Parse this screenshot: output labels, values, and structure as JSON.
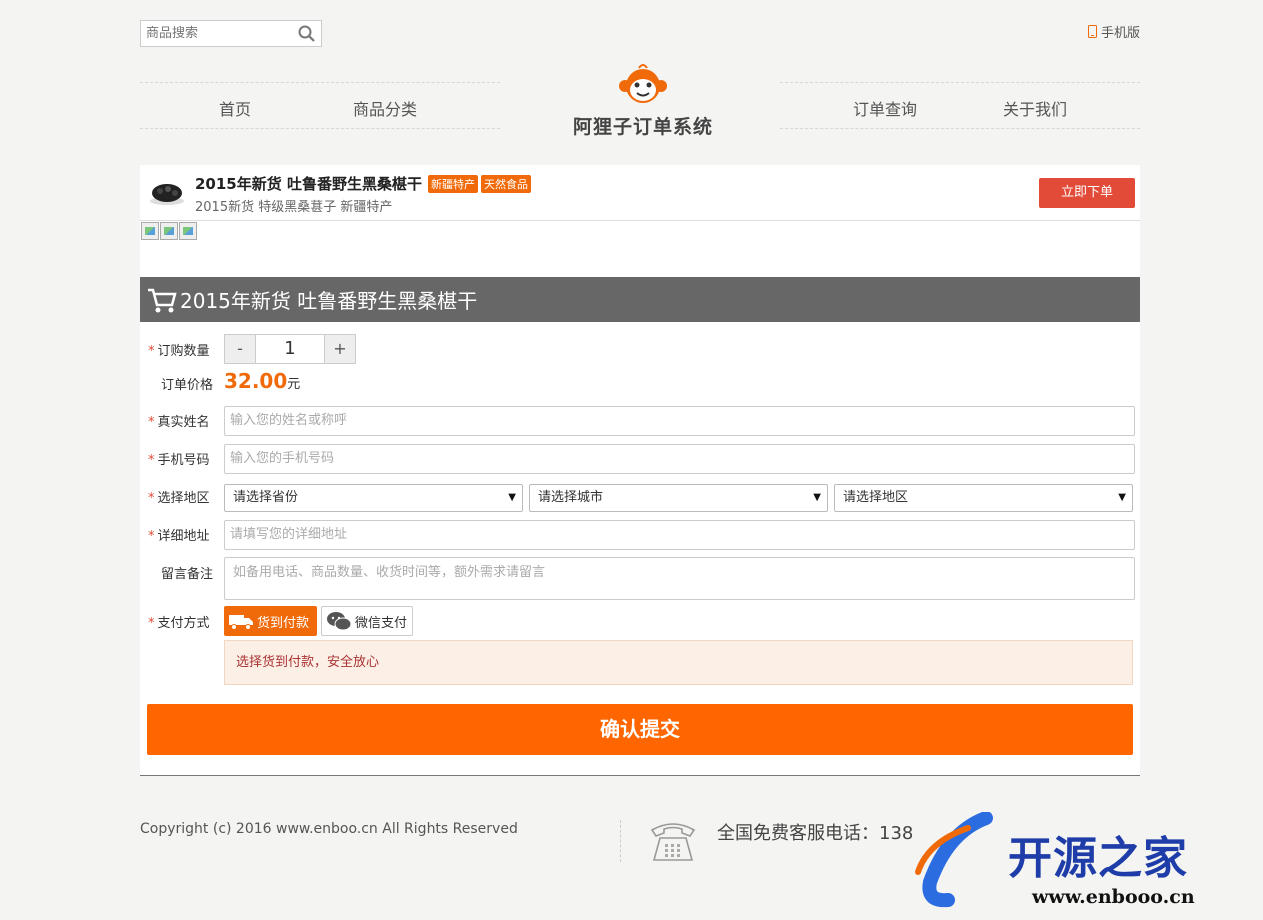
{
  "header": {
    "search_placeholder": "商品搜索",
    "mobile_label": "手机版"
  },
  "nav": {
    "items": [
      {
        "label": "首页"
      },
      {
        "label": "商品分类"
      },
      {
        "label": "订单查询"
      },
      {
        "label": "关于我们"
      }
    ],
    "logo_title": "阿狸子订单系统"
  },
  "product": {
    "title": "2015年新货 吐鲁番野生黑桑椹干",
    "badges": [
      "新疆特产",
      "天然食品"
    ],
    "subtitle": "2015新货 特级黑桑葚子 新疆特产",
    "buy_button": "立即下单"
  },
  "form": {
    "header_title": "2015年新货 吐鲁番野生黑桑椹干",
    "required_mark": "*",
    "quantity_label": "订购数量",
    "quantity_minus": "-",
    "quantity_value": "1",
    "quantity_plus": "+",
    "price_label": "订单价格",
    "price_value": "32.00",
    "price_unit": "元",
    "name_label": "真实姓名",
    "name_placeholder": "输入您的姓名或称呼",
    "phone_label": "手机号码",
    "phone_placeholder": "输入您的手机号码",
    "region_label": "选择地区",
    "province_select": "请选择省份",
    "city_select": "请选择城市",
    "district_select": "请选择地区",
    "address_label": "详细地址",
    "address_placeholder": "请填写您的详细地址",
    "remark_label": "留言备注",
    "remark_placeholder": "如备用电话、商品数量、收货时间等，额外需求请留言",
    "payment_label": "支付方式",
    "payment_options": [
      {
        "label": "货到付款",
        "selected": true
      },
      {
        "label": "微信支付",
        "selected": false
      }
    ],
    "payment_notice": "选择货到付款，安全放心",
    "submit_label": "确认提交"
  },
  "footer": {
    "copyright": "Copyright (c) 2016 www.enboo.cn All Rights Reserved",
    "hotline": "全国免费客服电话：138"
  },
  "watermark": {
    "text": "开源之家",
    "url": "www.enbooo.cn"
  },
  "colors": {
    "accent": "#ff6600",
    "badge": "#f06a0a",
    "buy_button": "#e24b38",
    "form_header": "#676767"
  }
}
